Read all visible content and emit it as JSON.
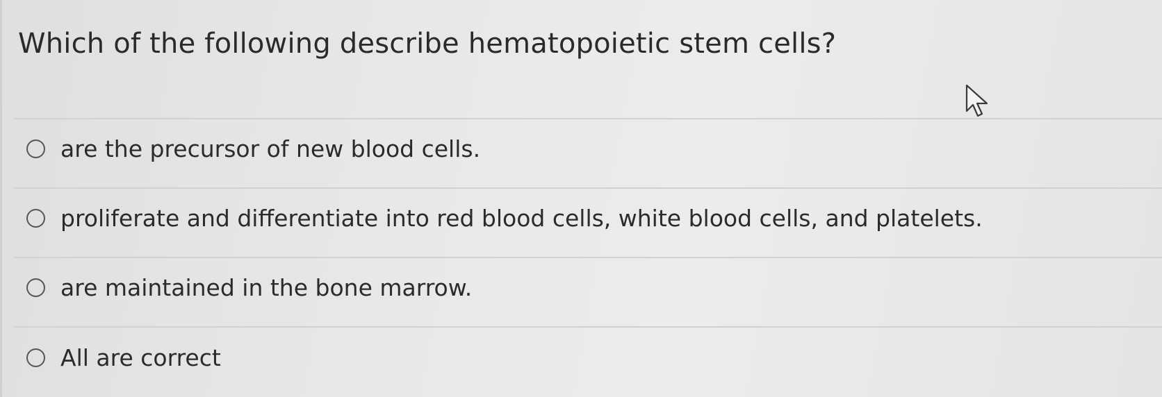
{
  "question": {
    "text": "Which of the following describe hematopoietic stem cells?"
  },
  "options": [
    {
      "label": "are the precursor of new blood cells.",
      "selected": false
    },
    {
      "label": "proliferate and differentiate into red blood cells, white blood cells, and platelets.",
      "selected": false
    },
    {
      "label": "are maintained in the bone marrow.",
      "selected": false
    },
    {
      "label": "All are correct",
      "selected": false
    }
  ],
  "cursor": {
    "icon": "pointer-arrow-icon"
  }
}
